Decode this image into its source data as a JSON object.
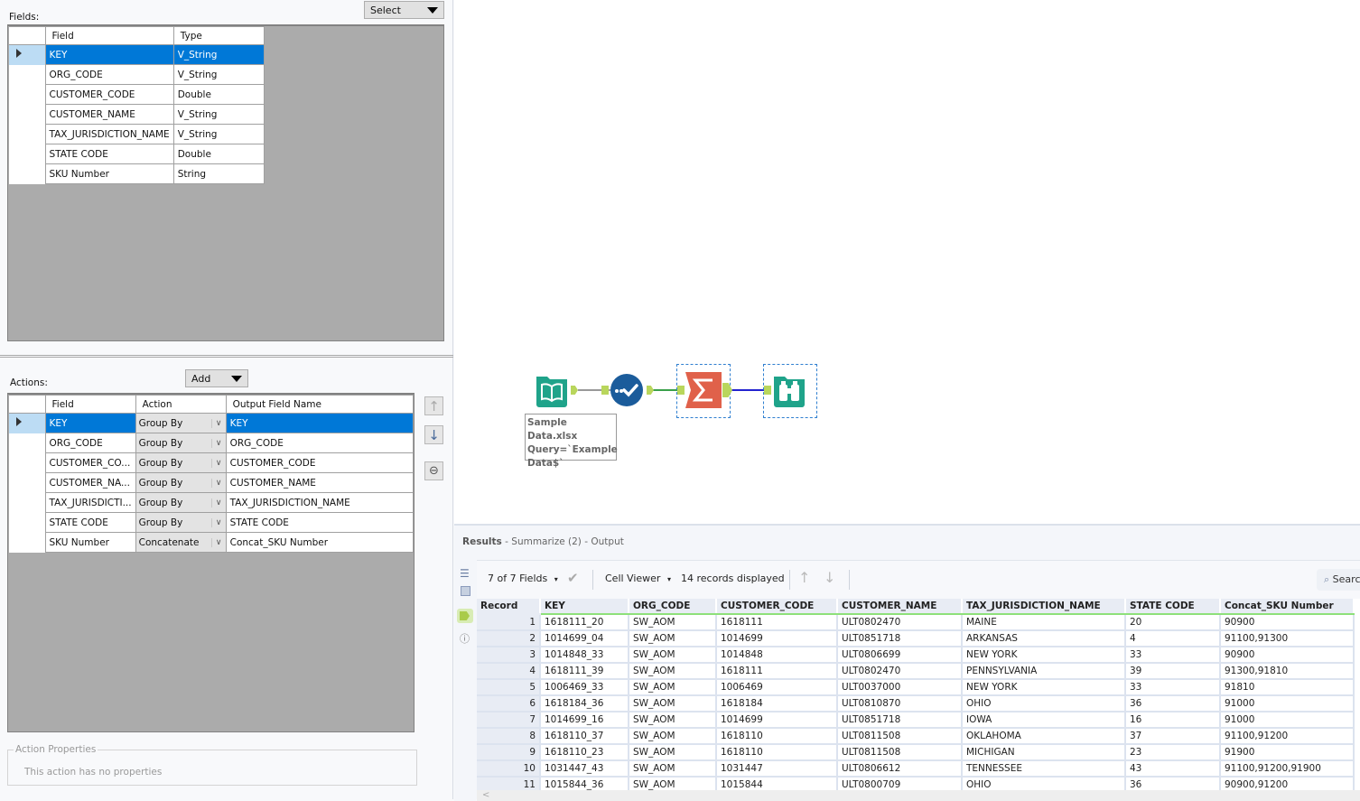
{
  "config": {
    "fields_label": "Fields:",
    "select_button": "Select",
    "fields_table": {
      "headers": [
        "Field",
        "Type"
      ],
      "rows": [
        {
          "field": "KEY",
          "type": "V_String",
          "selected": true
        },
        {
          "field": "ORG_CODE",
          "type": "V_String"
        },
        {
          "field": "CUSTOMER_CODE",
          "type": "Double"
        },
        {
          "field": "CUSTOMER_NAME",
          "type": "V_String"
        },
        {
          "field": "TAX_JURISDICTION_NAME",
          "type": "V_String"
        },
        {
          "field": "STATE CODE",
          "type": "Double"
        },
        {
          "field": "SKU Number",
          "type": "String"
        }
      ]
    },
    "actions_label": "Actions:",
    "add_button": "Add",
    "actions_table": {
      "headers": [
        "Field",
        "Action",
        "Output Field Name"
      ],
      "rows": [
        {
          "field": "KEY",
          "action": "Group By",
          "output": "KEY",
          "selected": true
        },
        {
          "field": "ORG_CODE",
          "action": "Group By",
          "output": "ORG_CODE"
        },
        {
          "field": "CUSTOMER_CO...",
          "action": "Group By",
          "output": "CUSTOMER_CODE"
        },
        {
          "field": "CUSTOMER_NA...",
          "action": "Group By",
          "output": "CUSTOMER_NAME"
        },
        {
          "field": "TAX_JURISDICTI...",
          "action": "Group By",
          "output": "TAX_JURISDICTION_NAME"
        },
        {
          "field": "STATE CODE",
          "action": "Group By",
          "output": "STATE CODE"
        },
        {
          "field": "SKU Number",
          "action": "Concatenate",
          "output": "Concat_SKU Number"
        }
      ]
    },
    "action_properties_legend": "Action Properties",
    "action_properties_note": "This action has no properties"
  },
  "canvas": {
    "tools": [
      {
        "name": "input-data",
        "color": "#1fa38a"
      },
      {
        "name": "select",
        "color": "#1b5c9b"
      },
      {
        "name": "summarize",
        "color": "#e0614a"
      },
      {
        "name": "browse",
        "color": "#1fa38a"
      }
    ],
    "annotation": [
      "Sample Data.xlsx",
      "Query=`Example",
      "Data$`"
    ]
  },
  "results": {
    "title": "Results",
    "subtitle": " - Summarize (2) - Output",
    "fields_selector": "7 of 7 Fields",
    "cell_viewer": "Cell Viewer",
    "records_displayed": "14 records displayed",
    "search_placeholder": "Search",
    "columns": [
      "Record",
      "KEY",
      "ORG_CODE",
      "CUSTOMER_CODE",
      "CUSTOMER_NAME",
      "TAX_JURISDICTION_NAME",
      "STATE CODE",
      "Concat_SKU Number"
    ],
    "rows": [
      [
        "1",
        "1618111_20",
        "SW_AOM",
        "1618111",
        "ULT0802470",
        "MAINE",
        "20",
        "90900"
      ],
      [
        "2",
        "1014699_04",
        "SW_AOM",
        "1014699",
        "ULT0851718",
        "ARKANSAS",
        "4",
        "91100,91300"
      ],
      [
        "3",
        "1014848_33",
        "SW_AOM",
        "1014848",
        "ULT0806699",
        "NEW YORK",
        "33",
        "90900"
      ],
      [
        "4",
        "1618111_39",
        "SW_AOM",
        "1618111",
        "ULT0802470",
        "PENNSYLVANIA",
        "39",
        "91300,91810"
      ],
      [
        "5",
        "1006469_33",
        "SW_AOM",
        "1006469",
        "ULT0037000",
        "NEW YORK",
        "33",
        "91810"
      ],
      [
        "6",
        "1618184_36",
        "SW_AOM",
        "1618184",
        "ULT0810870",
        "OHIO",
        "36",
        "91000"
      ],
      [
        "7",
        "1014699_16",
        "SW_AOM",
        "1014699",
        "ULT0851718",
        "IOWA",
        "16",
        "91000"
      ],
      [
        "8",
        "1618110_37",
        "SW_AOM",
        "1618110",
        "ULT0811508",
        "OKLAHOMA",
        "37",
        "91100,91200"
      ],
      [
        "9",
        "1618110_23",
        "SW_AOM",
        "1618110",
        "ULT0811508",
        "MICHIGAN",
        "23",
        "91900"
      ],
      [
        "10",
        "1031447_43",
        "SW_AOM",
        "1031447",
        "ULT0806612",
        "TENNESSEE",
        "43",
        "91100,91200,91900"
      ],
      [
        "11",
        "1015844_36",
        "SW_AOM",
        "1015844",
        "ULT0800709",
        "OHIO",
        "36",
        "90900,91200"
      ]
    ]
  }
}
